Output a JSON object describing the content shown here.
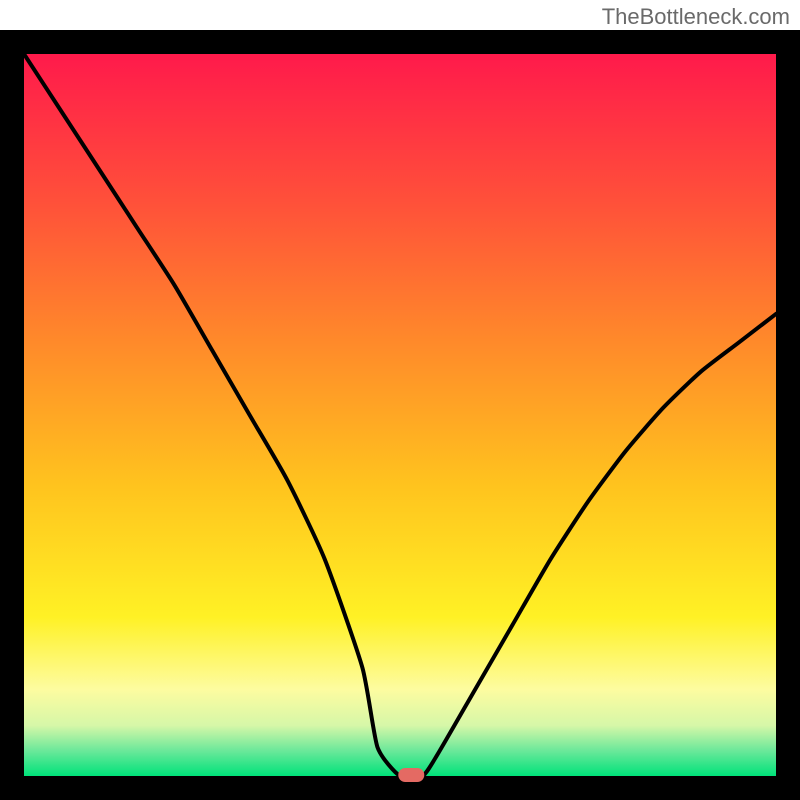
{
  "watermark": "TheBottleneck.com",
  "chart_data": {
    "type": "line",
    "title": "",
    "xlabel": "",
    "ylabel": "",
    "xlim": [
      0,
      100
    ],
    "ylim": [
      0,
      100
    ],
    "x": [
      0,
      5,
      10,
      15,
      20,
      25,
      30,
      35,
      40,
      45,
      47,
      50,
      53,
      55,
      60,
      65,
      70,
      75,
      80,
      85,
      90,
      95,
      100
    ],
    "values": [
      100,
      92,
      84,
      76,
      68,
      59,
      50,
      41,
      30,
      15,
      4,
      0,
      0,
      3,
      12,
      21,
      30,
      38,
      45,
      51,
      56,
      60,
      64
    ],
    "marker": {
      "x": 51.5,
      "y": 0
    },
    "gradient_stops": [
      {
        "offset": 0.0,
        "color": "#ff1a4b"
      },
      {
        "offset": 0.2,
        "color": "#ff4f3a"
      },
      {
        "offset": 0.4,
        "color": "#ff8a2a"
      },
      {
        "offset": 0.6,
        "color": "#ffc41e"
      },
      {
        "offset": 0.78,
        "color": "#fff125"
      },
      {
        "offset": 0.88,
        "color": "#fdfca0"
      },
      {
        "offset": 0.93,
        "color": "#d6f7a8"
      },
      {
        "offset": 0.965,
        "color": "#6be89a"
      },
      {
        "offset": 1.0,
        "color": "#00e27a"
      }
    ],
    "frame_color": "#000000",
    "frame_width": 24,
    "curve_color": "#000000",
    "curve_width": 4,
    "marker_color": "#e46a63"
  }
}
